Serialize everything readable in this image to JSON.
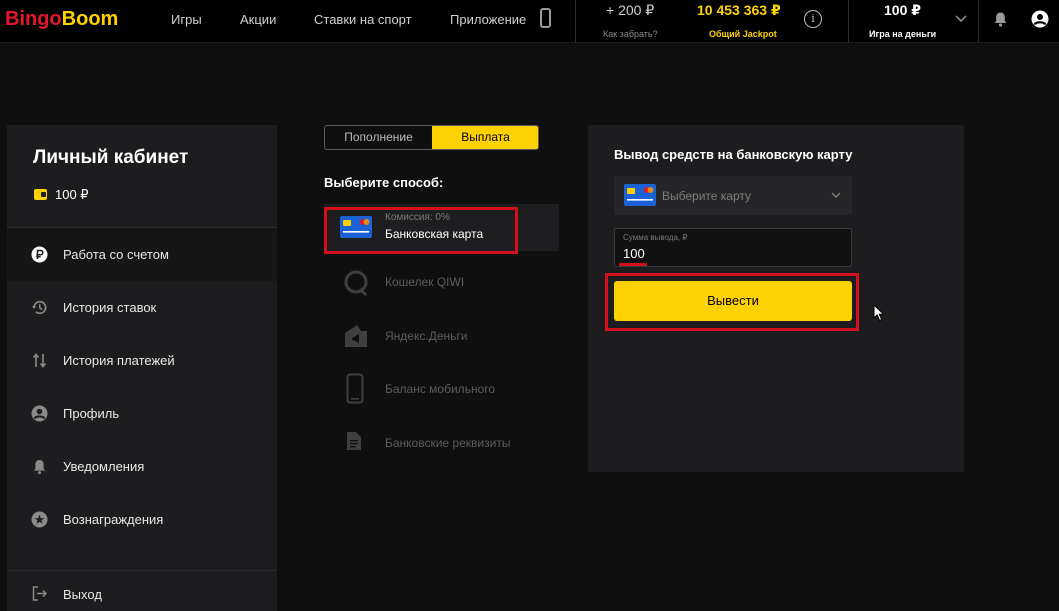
{
  "header": {
    "logo_part1": "Bingo",
    "logo_part2": "Boom",
    "nav": [
      "Игры",
      "Акции",
      "Ставки на спорт",
      "Приложение"
    ],
    "bonus_amount": "+ 200 ₽",
    "bonus_link": "Как забрать?",
    "jackpot_amount": "10 453 363 ₽",
    "jackpot_label": "Общий Jackpot",
    "info_glyph": "i",
    "balance_amount": "100 ₽",
    "balance_label": "Игра на деньги"
  },
  "sidebar": {
    "title": "Личный кабинет",
    "balance": "100 ₽",
    "items": [
      {
        "label": "Работа со счетом",
        "icon": "ruble-icon",
        "active": true
      },
      {
        "label": "История ставок",
        "icon": "history-icon"
      },
      {
        "label": "История платежей",
        "icon": "transfer-arrows-icon"
      },
      {
        "label": "Профиль",
        "icon": "profile-icon"
      },
      {
        "label": "Уведомления",
        "icon": "bell-icon"
      },
      {
        "label": "Вознаграждения",
        "icon": "star-badge-icon"
      }
    ],
    "logout": "Выход"
  },
  "tabs": {
    "topup": "Пополнение",
    "withdraw": "Выплата",
    "active": "withdraw"
  },
  "methods": {
    "heading": "Выберите способ:",
    "items": [
      {
        "label": "Банковская карта",
        "commission": "Комиссия: 0%",
        "icon": "bank-card-icon",
        "selected": true
      },
      {
        "label": "Кошелек QIWI",
        "icon": "qiwi-icon"
      },
      {
        "label": "Яндекс.Деньги",
        "icon": "yandex-money-icon"
      },
      {
        "label": "Баланс мобильного",
        "icon": "mobile-phone-icon"
      },
      {
        "label": "Банковские реквизиты",
        "icon": "document-icon"
      }
    ]
  },
  "withdraw_panel": {
    "title": "Вывод средств на банковскую карту",
    "card_placeholder": "Выберите карту",
    "amount_label": "Сумма вывода, ₽",
    "amount_value": "100",
    "submit_label": "Вывести"
  },
  "colors": {
    "accent": "#fed202",
    "brand_red": "#e2162c",
    "highlight": "#d5101d",
    "background": "#0f0f10",
    "panel": "#1d1d1f"
  }
}
